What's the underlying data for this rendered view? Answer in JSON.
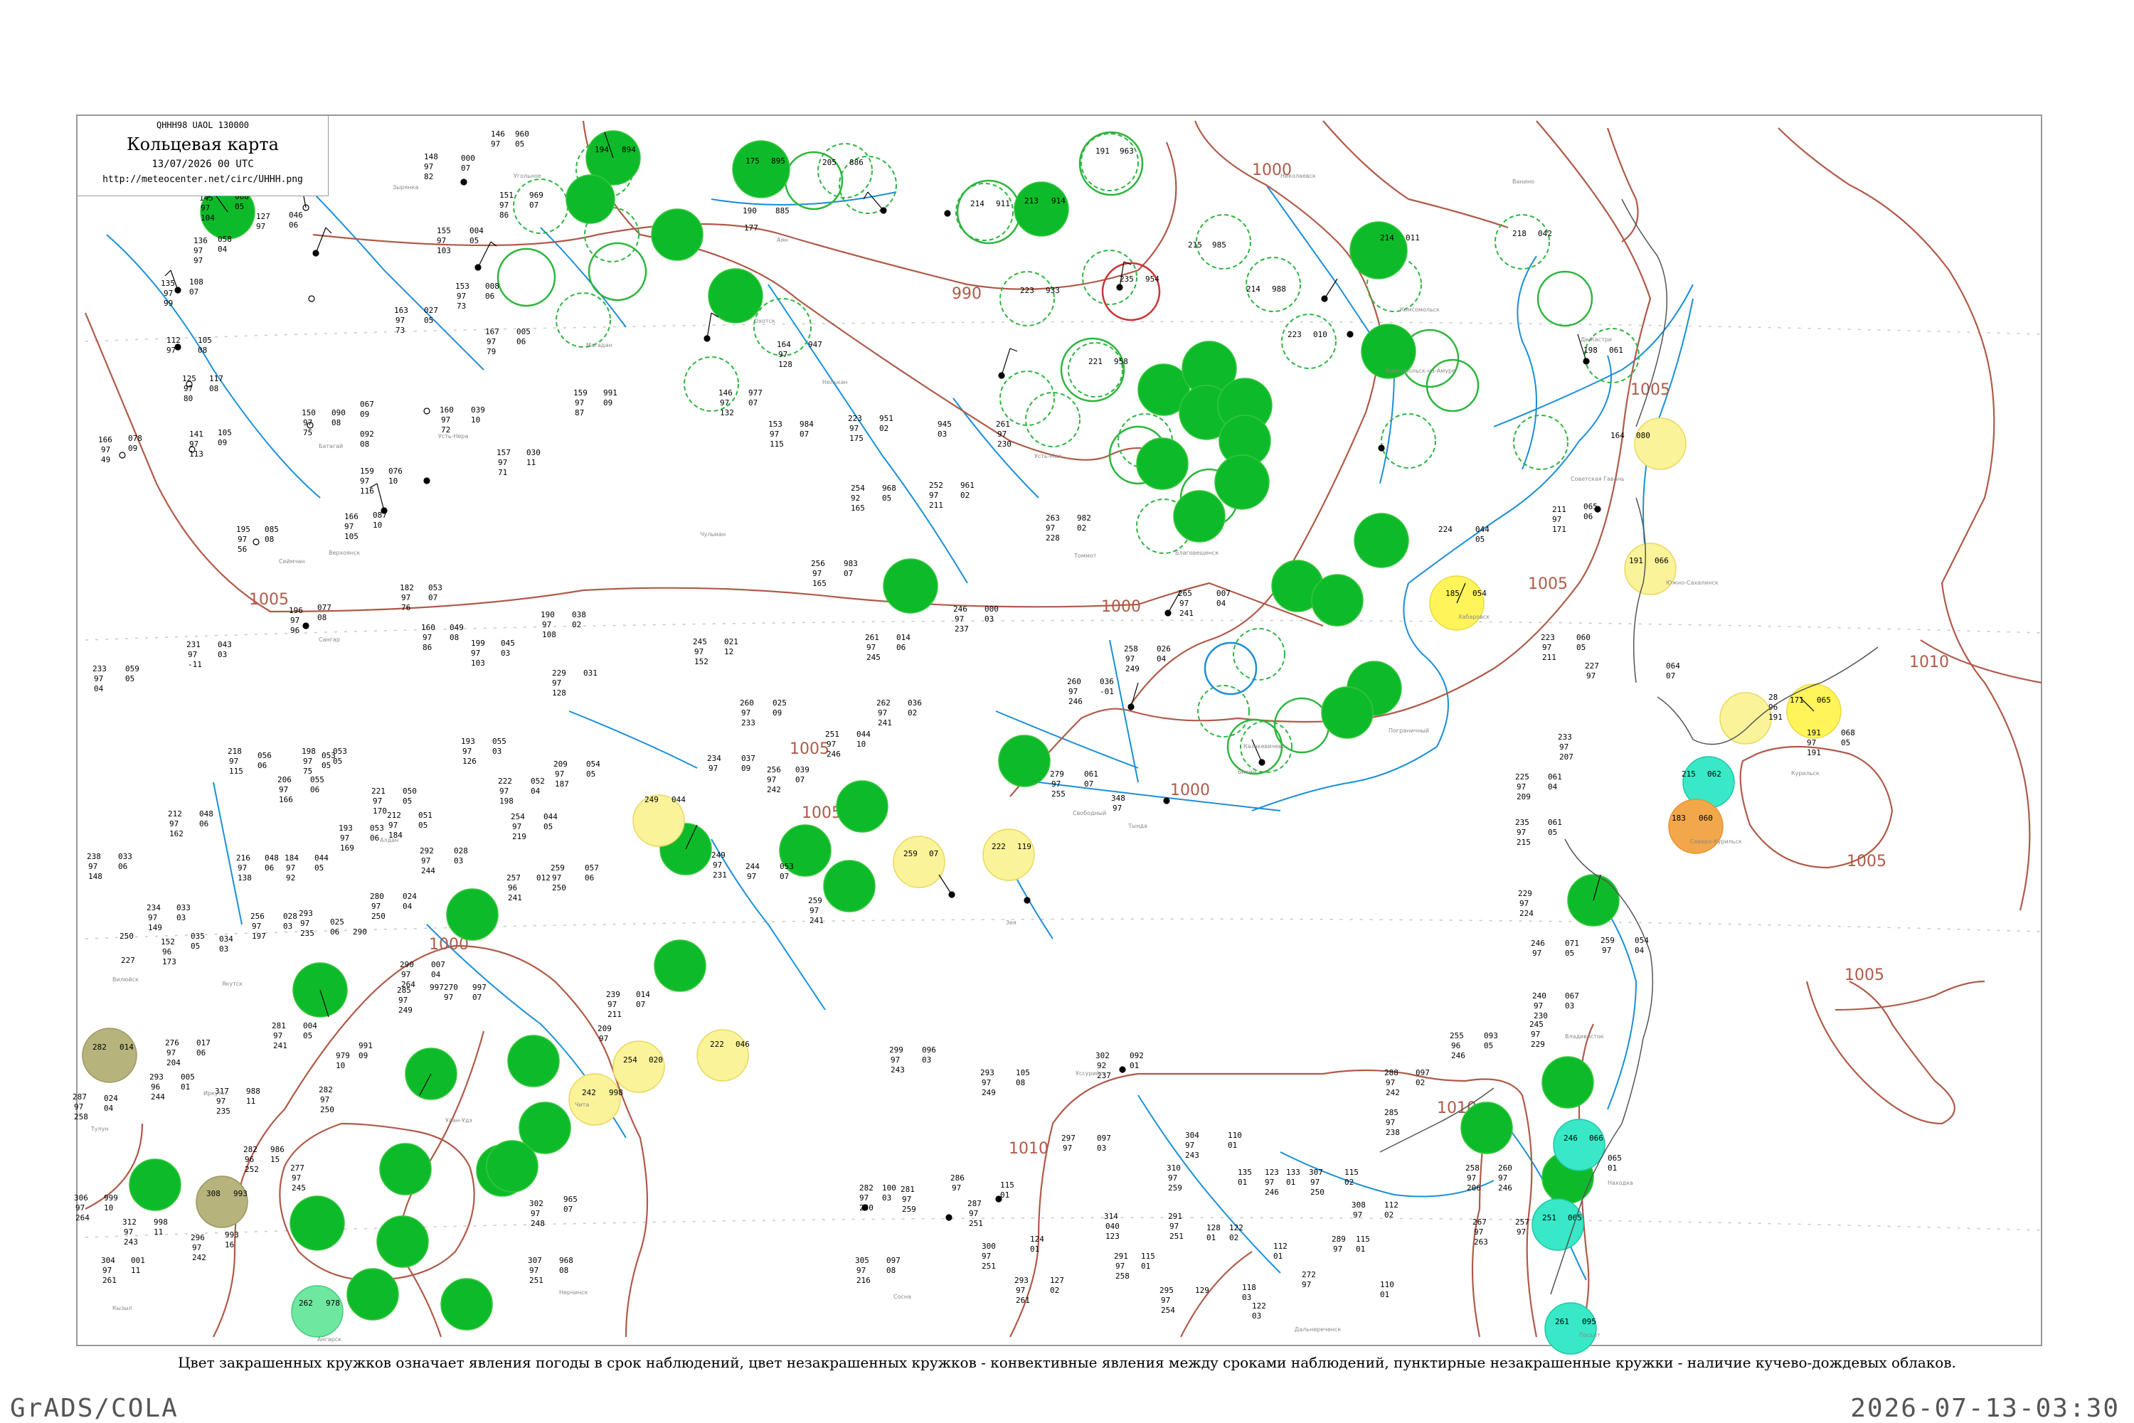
{
  "header": {
    "code": "QHHH98  UAOL  130000",
    "title": "Кольцевая карта",
    "datetime": "13/07/2026 00 UTC",
    "url": "http://meteocenter.net/circ/UHHH.png"
  },
  "caption": "Цвет закрашенных кружков означает явления погоды в срок наблюдений, цвет незакрашенных кружков - конвективные явления между сроками наблюдений, пунктирные незакрашенные кружки - наличие кучево-дождевых облаков.",
  "footer": {
    "left": "GrADS/COLA",
    "right": "2026-07-13-03:30"
  },
  "colors": {
    "frame": "#999999",
    "rivers": "#1a8fd8",
    "isobars": "#b05a48",
    "green": "#0dbb2a",
    "yellow": "#fff45a",
    "pale_yellow": "#fbf39a",
    "orange": "#f2a84a",
    "cyan": "#38e8c6",
    "olive": "#b6b47c",
    "light_green": "#6ee7a0"
  },
  "isobar_labels": [
    "1000",
    "990",
    "1005",
    "1000",
    "1000",
    "1005",
    "1005",
    "1010",
    "1005",
    "1005",
    "1000",
    "1010",
    "1010",
    "1005",
    "1005"
  ],
  "stations": [
    {
      "pressure": "885",
      "temp": "190",
      "dew": "177",
      "code": "",
      "fill": "",
      "ring": ""
    },
    {
      "pressure": "960",
      "temp": "146",
      "dew": "97",
      "code": "",
      "fill": "",
      "ring": ""
    },
    {
      "pressure": "947",
      "temp": "164",
      "dew": "128",
      "code": "",
      "fill": "",
      "ring": ""
    },
    {
      "pressure": "961",
      "temp": "252",
      "dew": "211",
      "code": "",
      "fill": "",
      "ring": ""
    },
    {
      "pressure": "982",
      "temp": "263",
      "dew": "228",
      "code": "",
      "fill": "",
      "ring": ""
    },
    {
      "pressure": "945",
      "temp": "261",
      "dew": "230",
      "code": "",
      "fill": "",
      "ring": ""
    },
    {
      "pressure": "007",
      "temp": "265",
      "dew": "241",
      "code": "",
      "fill": "",
      "ring": ""
    },
    {
      "pressure": "000",
      "temp": "246",
      "dew": "237",
      "code": "",
      "fill": "",
      "ring": ""
    },
    {
      "pressure": "036",
      "temp": "260",
      "dew": "",
      "code": "",
      "fill": "",
      "ring": ""
    },
    {
      "pressure": "044",
      "temp": "224",
      "dew": "",
      "code": "",
      "fill": "",
      "ring": ""
    },
    {
      "pressure": "054",
      "temp": "185",
      "dew": "185",
      "code": "",
      "fill": "yellow",
      "ring": ""
    },
    {
      "pressure": "080",
      "temp": "164",
      "dew": "164",
      "code": "",
      "fill": "pale_yellow",
      "ring": ""
    },
    {
      "pressure": "066",
      "temp": "191",
      "dew": "191",
      "code": "",
      "fill": "pale_yellow",
      "ring": ""
    },
    {
      "pressure": "065",
      "temp": "171",
      "dew": "171",
      "code": "",
      "fill": "yellow",
      "ring": ""
    },
    {
      "pressure": "063",
      "temp": "28",
      "dew": "191",
      "code": "",
      "fill": "pale_yellow",
      "ring": ""
    },
    {
      "pressure": "062",
      "temp": "215",
      "dew": "",
      "code": "",
      "fill": "cyan",
      "ring": ""
    },
    {
      "pressure": "060",
      "temp": "183",
      "dew": "183",
      "code": "",
      "fill": "orange",
      "ring": ""
    },
    {
      "pressure": "044",
      "temp": "249",
      "dew": "240",
      "code": "",
      "fill": "pale_yellow",
      "ring": ""
    },
    {
      "pressure": "119",
      "temp": "222",
      "dew": "220",
      "code": "",
      "fill": "pale_yellow",
      "ring": ""
    },
    {
      "pressure": "07",
      "temp": "259",
      "dew": "259",
      "code": "",
      "fill": "pale_yellow",
      "ring": ""
    },
    {
      "pressure": "046",
      "temp": "222",
      "dew": "222",
      "code": "",
      "fill": "pale_yellow",
      "ring": ""
    },
    {
      "pressure": "020",
      "temp": "254",
      "dew": "245",
      "code": "",
      "fill": "pale_yellow",
      "ring": ""
    },
    {
      "pressure": "998",
      "temp": "242",
      "dew": "235",
      "code": "",
      "fill": "pale_yellow",
      "ring": ""
    },
    {
      "pressure": "014",
      "temp": "282",
      "dew": "240",
      "code": "",
      "fill": "olive",
      "ring": ""
    },
    {
      "pressure": "993",
      "temp": "308",
      "dew": "243",
      "code": "",
      "fill": "olive",
      "ring": ""
    },
    {
      "pressure": "978",
      "temp": "262",
      "dew": "",
      "code": "",
      "fill": "light_green",
      "ring": ""
    },
    {
      "pressure": "066",
      "temp": "259",
      "dew": "",
      "code": "",
      "fill": "cyan",
      "ring": ""
    },
    {
      "pressure": "065",
      "temp": "251",
      "dew": "",
      "code": "",
      "fill": "cyan",
      "ring": ""
    },
    {
      "pressure": "095",
      "temp": "261",
      "dew": "261",
      "code": "",
      "fill": "cyan",
      "ring": ""
    }
  ]
}
